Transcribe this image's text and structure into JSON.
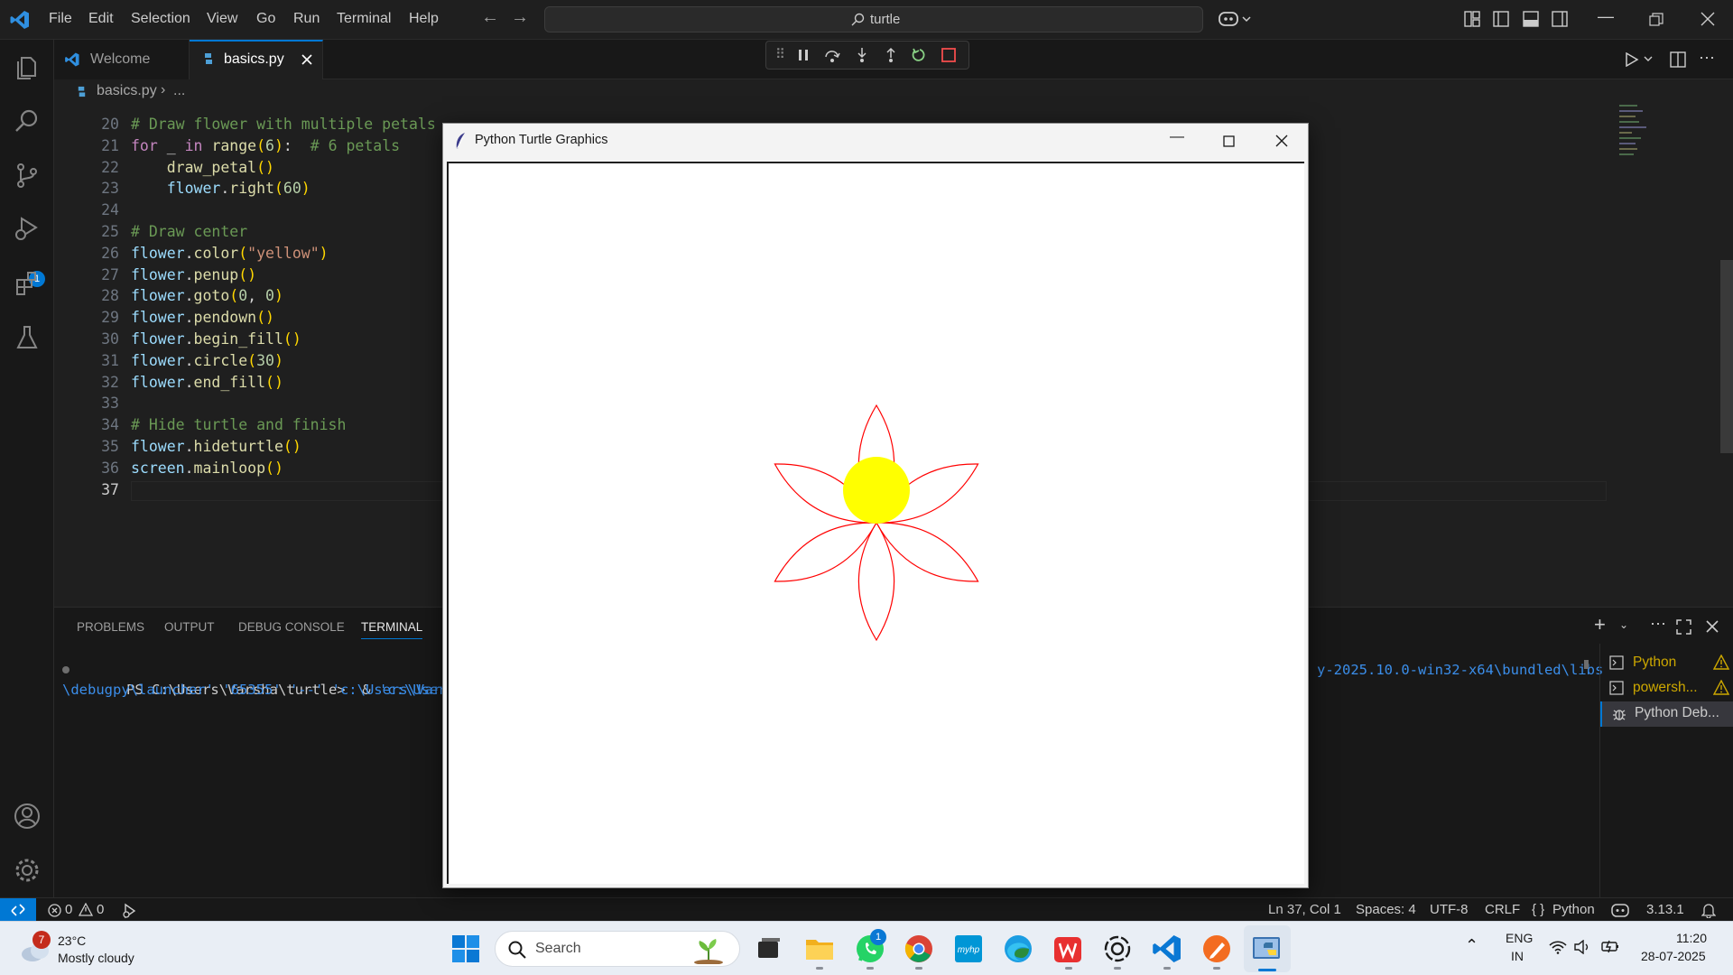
{
  "titlebar": {
    "menu": [
      "File",
      "Edit",
      "Selection",
      "View",
      "Go",
      "Run",
      "Terminal",
      "Help"
    ],
    "search_text": "turtle"
  },
  "activitybar": {
    "debug_badge": "1"
  },
  "tabs": [
    {
      "label": "Welcome",
      "active": false
    },
    {
      "label": "basics.py",
      "active": true
    }
  ],
  "breadcrumb": {
    "file": "basics.py",
    "rest": "..."
  },
  "editor": {
    "lines": [
      {
        "n": "20",
        "tokens": [
          [
            "cm",
            "# Draw flower with multiple petals"
          ]
        ]
      },
      {
        "n": "21",
        "tokens": [
          [
            "kw",
            "for"
          ],
          [
            "plain",
            " _ "
          ],
          [
            "kw",
            "in"
          ],
          [
            "plain",
            " "
          ],
          [
            "fn",
            "range"
          ],
          [
            "br1",
            "("
          ],
          [
            "num",
            "6"
          ],
          [
            "br1",
            ")"
          ],
          [
            "plain",
            ":  "
          ],
          [
            "cm",
            "# 6 petals"
          ]
        ]
      },
      {
        "n": "22",
        "tokens": [
          [
            "plain",
            "    "
          ],
          [
            "fn",
            "draw_petal"
          ],
          [
            "br1",
            "()"
          ]
        ]
      },
      {
        "n": "23",
        "tokens": [
          [
            "plain",
            "    "
          ],
          [
            "var",
            "flower"
          ],
          [
            "plain",
            "."
          ],
          [
            "fn",
            "right"
          ],
          [
            "br1",
            "("
          ],
          [
            "num",
            "60"
          ],
          [
            "br1",
            ")"
          ]
        ]
      },
      {
        "n": "24",
        "tokens": []
      },
      {
        "n": "25",
        "tokens": [
          [
            "cm",
            "# Draw center"
          ]
        ]
      },
      {
        "n": "26",
        "tokens": [
          [
            "var",
            "flower"
          ],
          [
            "plain",
            "."
          ],
          [
            "fn",
            "color"
          ],
          [
            "br1",
            "("
          ],
          [
            "str",
            "\"yellow\""
          ],
          [
            "br1",
            ")"
          ]
        ]
      },
      {
        "n": "27",
        "tokens": [
          [
            "var",
            "flower"
          ],
          [
            "plain",
            "."
          ],
          [
            "fn",
            "penup"
          ],
          [
            "br1",
            "()"
          ]
        ]
      },
      {
        "n": "28",
        "tokens": [
          [
            "var",
            "flower"
          ],
          [
            "plain",
            "."
          ],
          [
            "fn",
            "goto"
          ],
          [
            "br1",
            "("
          ],
          [
            "num",
            "0"
          ],
          [
            "plain",
            ", "
          ],
          [
            "num",
            "0"
          ],
          [
            "br1",
            ")"
          ]
        ]
      },
      {
        "n": "29",
        "tokens": [
          [
            "var",
            "flower"
          ],
          [
            "plain",
            "."
          ],
          [
            "fn",
            "pendown"
          ],
          [
            "br1",
            "()"
          ]
        ]
      },
      {
        "n": "30",
        "tokens": [
          [
            "var",
            "flower"
          ],
          [
            "plain",
            "."
          ],
          [
            "fn",
            "begin_fill"
          ],
          [
            "br1",
            "()"
          ]
        ]
      },
      {
        "n": "31",
        "tokens": [
          [
            "var",
            "flower"
          ],
          [
            "plain",
            "."
          ],
          [
            "fn",
            "circle"
          ],
          [
            "br1",
            "("
          ],
          [
            "num",
            "30"
          ],
          [
            "br1",
            ")"
          ]
        ]
      },
      {
        "n": "32",
        "tokens": [
          [
            "var",
            "flower"
          ],
          [
            "plain",
            "."
          ],
          [
            "fn",
            "end_fill"
          ],
          [
            "br1",
            "()"
          ]
        ]
      },
      {
        "n": "33",
        "tokens": []
      },
      {
        "n": "34",
        "tokens": [
          [
            "cm",
            "# Hide turtle and finish"
          ]
        ]
      },
      {
        "n": "35",
        "tokens": [
          [
            "var",
            "flower"
          ],
          [
            "plain",
            "."
          ],
          [
            "fn",
            "hideturtle"
          ],
          [
            "br1",
            "()"
          ]
        ]
      },
      {
        "n": "36",
        "tokens": [
          [
            "var",
            "screen"
          ],
          [
            "plain",
            "."
          ],
          [
            "fn",
            "mainloop"
          ],
          [
            "br1",
            "()"
          ]
        ]
      },
      {
        "n": "37",
        "tokens": []
      }
    ]
  },
  "panel": {
    "tabs": [
      "PROBLEMS",
      "OUTPUT",
      "DEBUG CONSOLE",
      "TERMINAL"
    ],
    "active_tab": "TERMINAL",
    "terminal_line1_prompt": "PS C:\\Users\\Varsha\\turtle>  & ",
    "terminal_line1_arg": "'c:\\Users\\Varsh",
    "terminal_line1_tail": "y-2025.10.0-win32-x64\\bundled\\libs",
    "terminal_line2": "\\debugpy\\launcher' '65355' '--' 'c:\\Users\\Var",
    "terminals": [
      {
        "label": "Python",
        "warn": true
      },
      {
        "label": "powersh...",
        "warn": true
      },
      {
        "label": "Python Deb...",
        "warn": false
      }
    ]
  },
  "statusbar": {
    "errors": "0",
    "warnings": "0",
    "position": "Ln 37, Col 1",
    "spaces": "Spaces: 4",
    "encoding": "UTF-8",
    "eol": "CRLF",
    "language": "Python",
    "version": "3.13.1"
  },
  "turtle_window": {
    "title": "Python Turtle Graphics",
    "petal_count": 6,
    "petal_color": "#ff0000",
    "center_color": "#ffff00"
  },
  "taskbar": {
    "weather_temp": "23°C",
    "weather_desc": "Mostly cloudy",
    "weather_badge": "7",
    "search_label": "Search",
    "whatsapp_badge": "1",
    "lang_top": "ENG",
    "lang_bottom": "IN",
    "time": "11:20",
    "date": "28-07-2025"
  }
}
